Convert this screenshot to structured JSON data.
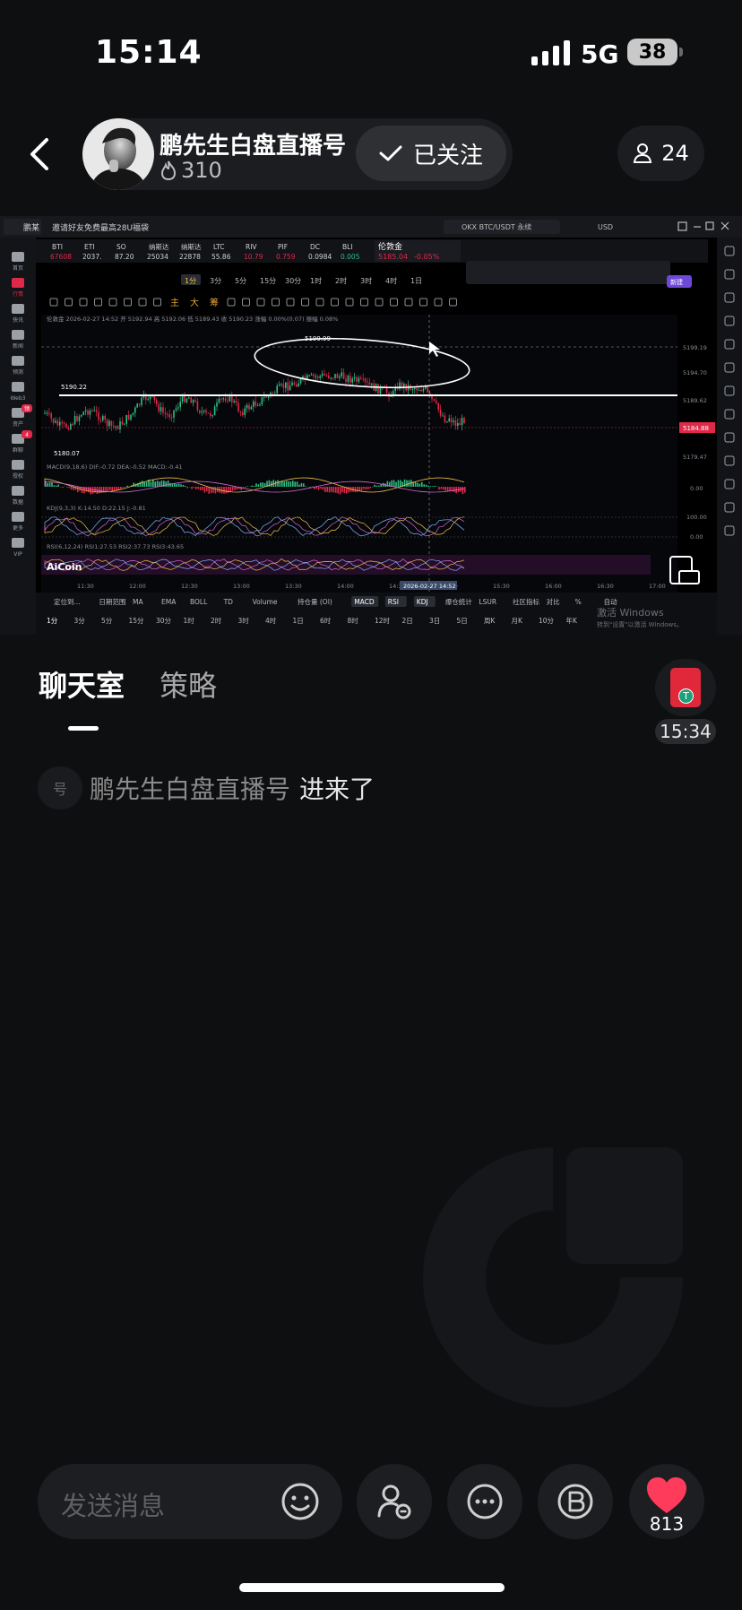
{
  "status": {
    "time": "15:14",
    "network": "5G",
    "battery": "38"
  },
  "header": {
    "host_name": "鹏先生白盘直播号",
    "heat": "310",
    "follow_label": "已关注",
    "viewers": "24"
  },
  "stream": {
    "top_tab": "鹏某",
    "promo_text": "邀请好友免费最高28U福袋",
    "pair_search": "OKX BTC/USDT 永续",
    "currency": "USD",
    "ticker_items": [
      {
        "name": "BTI",
        "value": "67608"
      },
      {
        "name": "ETI",
        "value": "2037."
      },
      {
        "name": "SO",
        "value": "87.20"
      },
      {
        "name": "纳斯达",
        "value": "25034"
      },
      {
        "name": "纳斯达",
        "value": "22878"
      },
      {
        "name": "LTC",
        "value": "55.86"
      },
      {
        "name": "RIV",
        "value": "10.79"
      },
      {
        "name": "PIF",
        "value": "0.759"
      },
      {
        "name": "DC",
        "value": "0.0984"
      },
      {
        "name": "BLI",
        "value": "0.005"
      }
    ],
    "focus_ticker": {
      "name": "伦敦金",
      "value": "5185.04",
      "change": "-0.05%"
    },
    "timeframes": [
      "1分",
      "3分",
      "5分",
      "15分",
      "30分",
      "1时",
      "2时",
      "3时",
      "4时",
      "1日"
    ],
    "active_timeframe": "1分",
    "toolbar_labels": [
      "主",
      "大",
      "筹"
    ],
    "ohlc_line": "伦敦金 2026-02-27 14:52 开 5192.94 高 5192.06 低 5189.43 收 5190.23 涨幅 0.00%(0.07) 振幅 0.08%",
    "price_labels": {
      "peak": "5199.99",
      "level": "5190.22",
      "low": "5180.07"
    },
    "right_axis": [
      "5199.19",
      "5194.70",
      "5189.62",
      "5184.88",
      "5179.47"
    ],
    "current_price": "5184.88",
    "indicators": {
      "macd": "MACD(9,18,6)  DIF:-0.72  DEA:-0.52  MACD:-0.41",
      "kdj": "KDJ(9,3,3)  K:14.50  D:22.15  J:-0.81",
      "rsi": "RSI(6,12,24)  RSI1:27.53  RSI2:37.73  RSI3:43.65",
      "macd_axis": "0.00",
      "kdj_axis": [
        "100.00",
        "0.00"
      ]
    },
    "time_axis": [
      "11:30",
      "12:00",
      "12:30",
      "13:00",
      "13:30",
      "14:00",
      "14:30",
      "15:00",
      "15:30",
      "16:00",
      "16:30",
      "17:00"
    ],
    "cursor_time": "2026-02-27 14:52",
    "brand": "AiCoin",
    "indicator_tabs": [
      "定位到...",
      "日期范围",
      "MA",
      "EMA",
      "BOLL",
      "TD",
      "Volume",
      "持仓量 (OI)",
      "MACD",
      "RSI",
      "KDJ",
      "爆仓统计",
      "LSUR",
      "社区指标",
      "对比",
      "%",
      "自动"
    ],
    "bottom_timeframes": [
      "1分",
      "3分",
      "5分",
      "15分",
      "30分",
      "1时",
      "2时",
      "3时",
      "4时",
      "1日",
      "6时",
      "8时",
      "12时",
      "2日",
      "3日",
      "5日",
      "周K",
      "月K",
      "10分",
      "年K"
    ],
    "windows_notice": [
      "激活 Windows",
      "转到\"设置\"以激活 Windows。"
    ],
    "left_nav": [
      "首页",
      "行情",
      "快讯",
      "新闻",
      "预测",
      "Web3",
      "资产",
      "群聊",
      "授权",
      "数据",
      "更多",
      "VIP"
    ],
    "left_nav_badges": {
      "资产": "领",
      "群聊": "4"
    },
    "new_badge": "新建"
  },
  "tabs": {
    "chat": "聊天室",
    "strategy": "策略"
  },
  "red_packet": {
    "time": "15:34"
  },
  "chat": [
    {
      "badge": "号",
      "user": "鹏先生白盘直播号",
      "text": "进来了"
    }
  ],
  "input": {
    "placeholder": "发送消息"
  },
  "likes": {
    "count": "813"
  },
  "colors": {
    "background": "#0e0f11",
    "like": "#ff3b5c",
    "candle_up": "#2ebd85",
    "candle_down": "#e0294a"
  }
}
